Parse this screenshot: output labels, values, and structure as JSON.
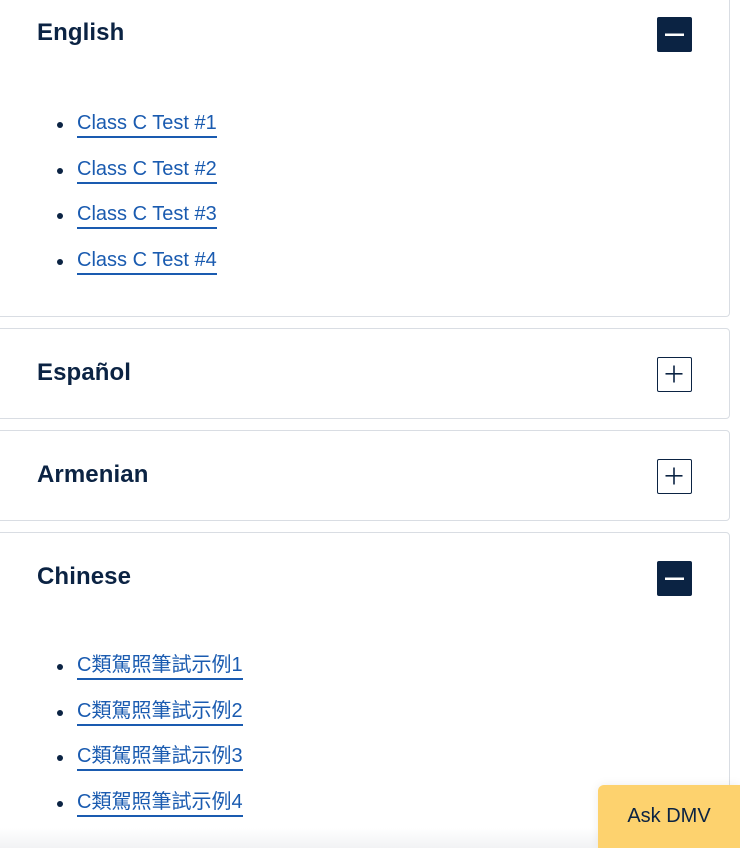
{
  "accordion": {
    "english": {
      "title": "English",
      "expanded": true,
      "links": [
        "Class C Test #1",
        "Class C Test #2",
        "Class C Test #3",
        "Class C Test #4"
      ]
    },
    "espanol": {
      "title": "Español",
      "expanded": false
    },
    "armenian": {
      "title": "Armenian",
      "expanded": false
    },
    "chinese": {
      "title": "Chinese",
      "expanded": true,
      "links": [
        "C類駕照筆試示例1",
        "C類駕照筆試示例2",
        "C類駕照筆試示例3",
        "C類駕照筆試示例4"
      ]
    }
  },
  "chat_widget": {
    "label": "Ask DMV"
  },
  "icons": {
    "collapse": "minus-icon",
    "expand": "plus-icon"
  },
  "colors": {
    "navy": "#0b2343",
    "link": "#1a5bb0",
    "accent_yellow": "#fdd26e",
    "border": "#d9dde3"
  }
}
